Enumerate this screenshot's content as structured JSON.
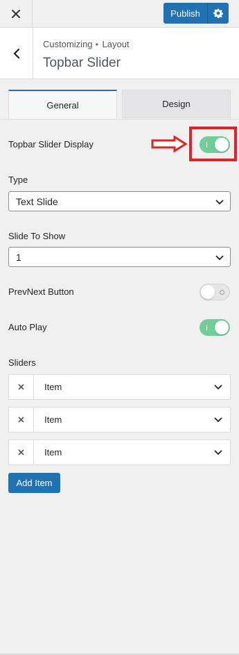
{
  "topbar": {
    "publish_label": "Publish"
  },
  "header": {
    "breadcrumb_root": "Customizing",
    "breadcrumb_section": "Layout",
    "title": "Topbar Slider"
  },
  "tabs": [
    {
      "label": "General",
      "active": true
    },
    {
      "label": "Design",
      "active": false
    }
  ],
  "fields": {
    "topbar_display": {
      "label": "Topbar Slider Display",
      "on": true
    },
    "type": {
      "label": "Type",
      "value": "Text Slide"
    },
    "slide_to_show": {
      "label": "Slide To Show",
      "value": "1"
    },
    "prevnext": {
      "label": "PrevNext Button",
      "on": false
    },
    "autoplay": {
      "label": "Auto Play",
      "on": true
    }
  },
  "sliders": {
    "label": "Sliders",
    "items": [
      {
        "label": "Item"
      },
      {
        "label": "Item"
      },
      {
        "label": "Item"
      }
    ],
    "add_label": "Add Item"
  },
  "colors": {
    "accent": "#2271b1",
    "toggle_on": "#6fcf97",
    "highlight": "#e02424"
  }
}
